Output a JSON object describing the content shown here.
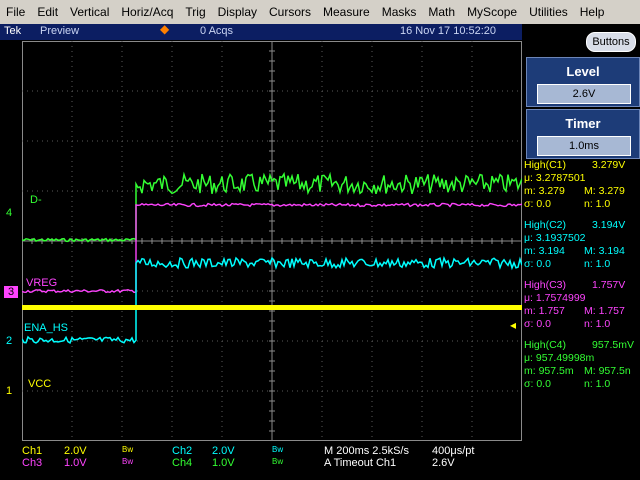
{
  "menu": [
    "File",
    "Edit",
    "Vertical",
    "Horiz/Acq",
    "Trig",
    "Display",
    "Cursors",
    "Measure",
    "Masks",
    "Math",
    "MyScope",
    "Utilities",
    "Help"
  ],
  "status": {
    "brand": "Tek",
    "mode": "Preview",
    "acqs": "0 Acqs",
    "datetime": "16 Nov 17 10:52:20"
  },
  "buttons_label": "Buttons",
  "level": {
    "title": "Level",
    "value": "2.6V"
  },
  "timer": {
    "title": "Timer",
    "value": "1.0ms"
  },
  "measurements": [
    {
      "header": "High(C1)",
      "value": "3.279V",
      "mu": "μ: 3.2787501",
      "m": "m: 3.279",
      "M": "M: 3.279",
      "sigma": "σ: 0.0",
      "n": "n: 1.0",
      "color": "#ffff00"
    },
    {
      "header": "High(C2)",
      "value": "3.194V",
      "mu": "μ: 3.1937502",
      "m": "m: 3.194",
      "M": "M: 3.194",
      "sigma": "σ: 0.0",
      "n": "n: 1.0",
      "color": "#00ffff"
    },
    {
      "header": "High(C3)",
      "value": "1.757V",
      "mu": "μ: 1.7574999",
      "m": "m: 1.757",
      "M": "M: 1.757",
      "sigma": "σ: 0.0",
      "n": "n: 1.0",
      "color": "#ff44ff"
    },
    {
      "header": "High(C4)",
      "value": "957.5mV",
      "mu": "μ: 957.49998m",
      "m": "m: 957.5m",
      "M": "M: 957.5n",
      "sigma": "σ: 0.0",
      "n": "n: 1.0",
      "color": "#33ff33"
    }
  ],
  "channel_labels": {
    "ch4": {
      "num": "4",
      "name": "D-"
    },
    "ch3": {
      "num": "3",
      "name": "VREG"
    },
    "ch2": {
      "num": "2",
      "name": "ENA_HS"
    },
    "ch1": {
      "num": "1",
      "name": "VCC"
    }
  },
  "bottom": {
    "ch1": "Ch1",
    "ch1_scale": "2.0V",
    "ch1_bw": "Bw",
    "ch2": "Ch2",
    "ch2_scale": "2.0V",
    "ch2_bw": "Bw",
    "ch3": "Ch3",
    "ch3_scale": "1.0V",
    "ch3_bw": "Bw",
    "ch4": "Ch4",
    "ch4_scale": "1.0V",
    "ch4_bw": "Bw",
    "timebase": "M 200ms 2.5kS/s",
    "sample_interval": "400μs/pt",
    "trigger": "A  Timeout  Ch1",
    "trigger_level": "2.6V"
  },
  "colors": {
    "ch1": "#ffff00",
    "ch2": "#00ffff",
    "ch3": "#ff44ff",
    "ch4": "#33ff33"
  },
  "icons": [
    "trigger-position-marker-icon",
    "trigger-level-arrow-icon"
  ]
}
